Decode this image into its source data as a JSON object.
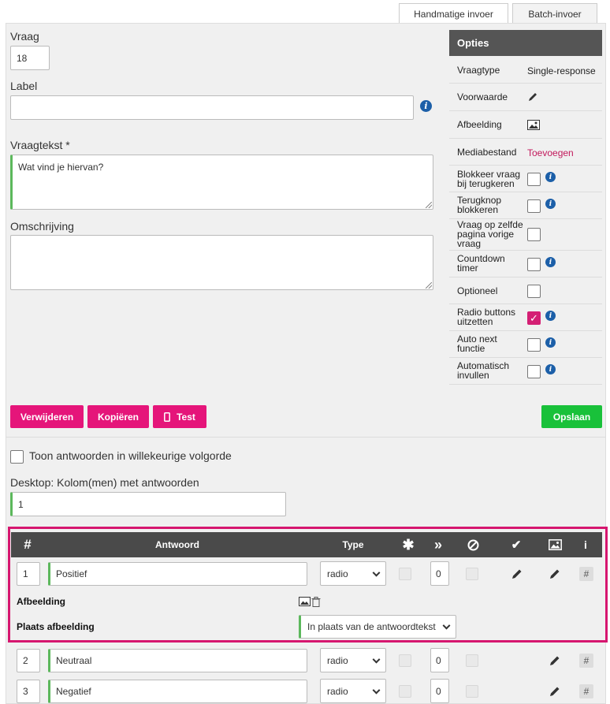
{
  "tabs": [
    {
      "label": "Handmatige invoer",
      "active": true
    },
    {
      "label": "Batch-invoer",
      "active": false
    }
  ],
  "form": {
    "vraag_label": "Vraag",
    "vraag_value": "18",
    "label_label": "Label",
    "label_value": "",
    "vraagtekst_label": "Vraagtekst *",
    "vraagtekst_value": "Wat vind je hiervan?",
    "omschrijving_label": "Omschrijving",
    "omschrijving_value": ""
  },
  "options": {
    "title": "Opties",
    "rows": [
      {
        "key": "Vraagtype",
        "value": "Single-response"
      },
      {
        "key": "Voorwaarde",
        "icon": "pencil-icon"
      },
      {
        "key": "Afbeelding",
        "icon": "image-icon"
      },
      {
        "key": "Mediabestand",
        "link": "Toevoegen"
      },
      {
        "key": "Blokkeer vraag bij terugkeren",
        "checked": false,
        "info": true
      },
      {
        "key": "Terugknop blokkeren",
        "checked": false,
        "info": true
      },
      {
        "key": "Vraag op zelfde pagina vorige vraag",
        "checked": false,
        "info": false
      },
      {
        "key": "Countdown timer",
        "checked": false,
        "info": true
      },
      {
        "key": "Optioneel",
        "checked": false,
        "info": false
      },
      {
        "key": "Radio buttons uitzetten",
        "checked": true,
        "info": true
      },
      {
        "key": "Auto next functie",
        "checked": false,
        "info": true
      },
      {
        "key": "Automatisch invullen",
        "checked": false,
        "info": true
      }
    ]
  },
  "buttons": {
    "delete": "Verwijderen",
    "copy": "Kopiëren",
    "test": "Test",
    "save": "Opslaan"
  },
  "random_order_label": "Toon antwoorden in willekeurige volgorde",
  "columns_label": "Desktop: Kolom(men) met antwoorden",
  "columns_value": "1",
  "table": {
    "headers": {
      "num": "#",
      "answer": "Antwoord",
      "type": "Type"
    },
    "header_icons": [
      "asterisk-icon",
      "double-chevron-icon",
      "ban-icon",
      "check-icon",
      "image-icon",
      "info-icon"
    ],
    "rows": [
      {
        "num": "1",
        "answer": "Positief",
        "type": "radio",
        "skip": "0"
      },
      {
        "num": "2",
        "answer": "Neutraal",
        "type": "radio",
        "skip": "0"
      },
      {
        "num": "3",
        "answer": "Negatief",
        "type": "radio",
        "skip": "0"
      }
    ],
    "row_hash": "#",
    "image_label": "Afbeelding",
    "image_place_label": "Plaats afbeelding",
    "image_place_value": "In plaats van de antwoordtekst"
  },
  "colors": {
    "accent": "#e5157a",
    "save": "#19c13a",
    "info": "#1c5fa8",
    "header": "#555555"
  }
}
